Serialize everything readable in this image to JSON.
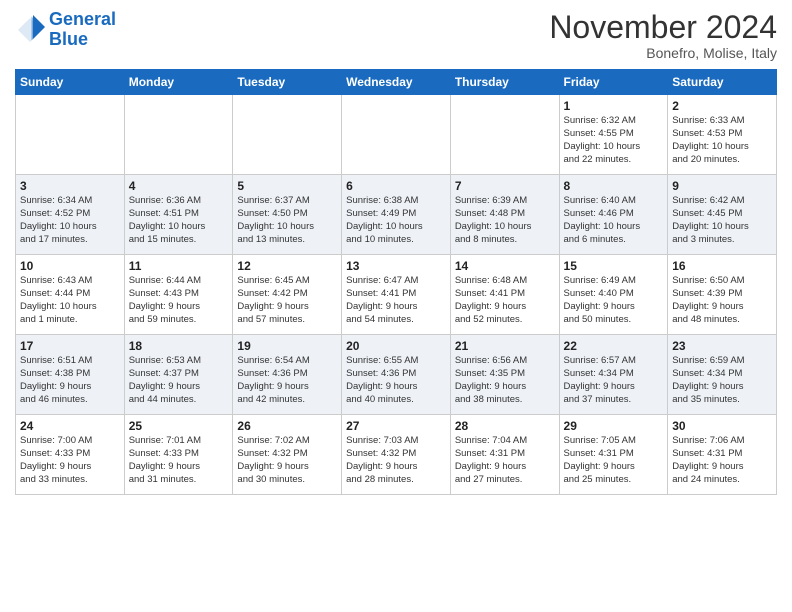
{
  "header": {
    "logo_line1": "General",
    "logo_line2": "Blue",
    "month": "November 2024",
    "location": "Bonefro, Molise, Italy"
  },
  "weekdays": [
    "Sunday",
    "Monday",
    "Tuesday",
    "Wednesday",
    "Thursday",
    "Friday",
    "Saturday"
  ],
  "weeks": [
    [
      {
        "day": "",
        "info": ""
      },
      {
        "day": "",
        "info": ""
      },
      {
        "day": "",
        "info": ""
      },
      {
        "day": "",
        "info": ""
      },
      {
        "day": "",
        "info": ""
      },
      {
        "day": "1",
        "info": "Sunrise: 6:32 AM\nSunset: 4:55 PM\nDaylight: 10 hours\nand 22 minutes."
      },
      {
        "day": "2",
        "info": "Sunrise: 6:33 AM\nSunset: 4:53 PM\nDaylight: 10 hours\nand 20 minutes."
      }
    ],
    [
      {
        "day": "3",
        "info": "Sunrise: 6:34 AM\nSunset: 4:52 PM\nDaylight: 10 hours\nand 17 minutes."
      },
      {
        "day": "4",
        "info": "Sunrise: 6:36 AM\nSunset: 4:51 PM\nDaylight: 10 hours\nand 15 minutes."
      },
      {
        "day": "5",
        "info": "Sunrise: 6:37 AM\nSunset: 4:50 PM\nDaylight: 10 hours\nand 13 minutes."
      },
      {
        "day": "6",
        "info": "Sunrise: 6:38 AM\nSunset: 4:49 PM\nDaylight: 10 hours\nand 10 minutes."
      },
      {
        "day": "7",
        "info": "Sunrise: 6:39 AM\nSunset: 4:48 PM\nDaylight: 10 hours\nand 8 minutes."
      },
      {
        "day": "8",
        "info": "Sunrise: 6:40 AM\nSunset: 4:46 PM\nDaylight: 10 hours\nand 6 minutes."
      },
      {
        "day": "9",
        "info": "Sunrise: 6:42 AM\nSunset: 4:45 PM\nDaylight: 10 hours\nand 3 minutes."
      }
    ],
    [
      {
        "day": "10",
        "info": "Sunrise: 6:43 AM\nSunset: 4:44 PM\nDaylight: 10 hours\nand 1 minute."
      },
      {
        "day": "11",
        "info": "Sunrise: 6:44 AM\nSunset: 4:43 PM\nDaylight: 9 hours\nand 59 minutes."
      },
      {
        "day": "12",
        "info": "Sunrise: 6:45 AM\nSunset: 4:42 PM\nDaylight: 9 hours\nand 57 minutes."
      },
      {
        "day": "13",
        "info": "Sunrise: 6:47 AM\nSunset: 4:41 PM\nDaylight: 9 hours\nand 54 minutes."
      },
      {
        "day": "14",
        "info": "Sunrise: 6:48 AM\nSunset: 4:41 PM\nDaylight: 9 hours\nand 52 minutes."
      },
      {
        "day": "15",
        "info": "Sunrise: 6:49 AM\nSunset: 4:40 PM\nDaylight: 9 hours\nand 50 minutes."
      },
      {
        "day": "16",
        "info": "Sunrise: 6:50 AM\nSunset: 4:39 PM\nDaylight: 9 hours\nand 48 minutes."
      }
    ],
    [
      {
        "day": "17",
        "info": "Sunrise: 6:51 AM\nSunset: 4:38 PM\nDaylight: 9 hours\nand 46 minutes."
      },
      {
        "day": "18",
        "info": "Sunrise: 6:53 AM\nSunset: 4:37 PM\nDaylight: 9 hours\nand 44 minutes."
      },
      {
        "day": "19",
        "info": "Sunrise: 6:54 AM\nSunset: 4:36 PM\nDaylight: 9 hours\nand 42 minutes."
      },
      {
        "day": "20",
        "info": "Sunrise: 6:55 AM\nSunset: 4:36 PM\nDaylight: 9 hours\nand 40 minutes."
      },
      {
        "day": "21",
        "info": "Sunrise: 6:56 AM\nSunset: 4:35 PM\nDaylight: 9 hours\nand 38 minutes."
      },
      {
        "day": "22",
        "info": "Sunrise: 6:57 AM\nSunset: 4:34 PM\nDaylight: 9 hours\nand 37 minutes."
      },
      {
        "day": "23",
        "info": "Sunrise: 6:59 AM\nSunset: 4:34 PM\nDaylight: 9 hours\nand 35 minutes."
      }
    ],
    [
      {
        "day": "24",
        "info": "Sunrise: 7:00 AM\nSunset: 4:33 PM\nDaylight: 9 hours\nand 33 minutes."
      },
      {
        "day": "25",
        "info": "Sunrise: 7:01 AM\nSunset: 4:33 PM\nDaylight: 9 hours\nand 31 minutes."
      },
      {
        "day": "26",
        "info": "Sunrise: 7:02 AM\nSunset: 4:32 PM\nDaylight: 9 hours\nand 30 minutes."
      },
      {
        "day": "27",
        "info": "Sunrise: 7:03 AM\nSunset: 4:32 PM\nDaylight: 9 hours\nand 28 minutes."
      },
      {
        "day": "28",
        "info": "Sunrise: 7:04 AM\nSunset: 4:31 PM\nDaylight: 9 hours\nand 27 minutes."
      },
      {
        "day": "29",
        "info": "Sunrise: 7:05 AM\nSunset: 4:31 PM\nDaylight: 9 hours\nand 25 minutes."
      },
      {
        "day": "30",
        "info": "Sunrise: 7:06 AM\nSunset: 4:31 PM\nDaylight: 9 hours\nand 24 minutes."
      }
    ]
  ]
}
